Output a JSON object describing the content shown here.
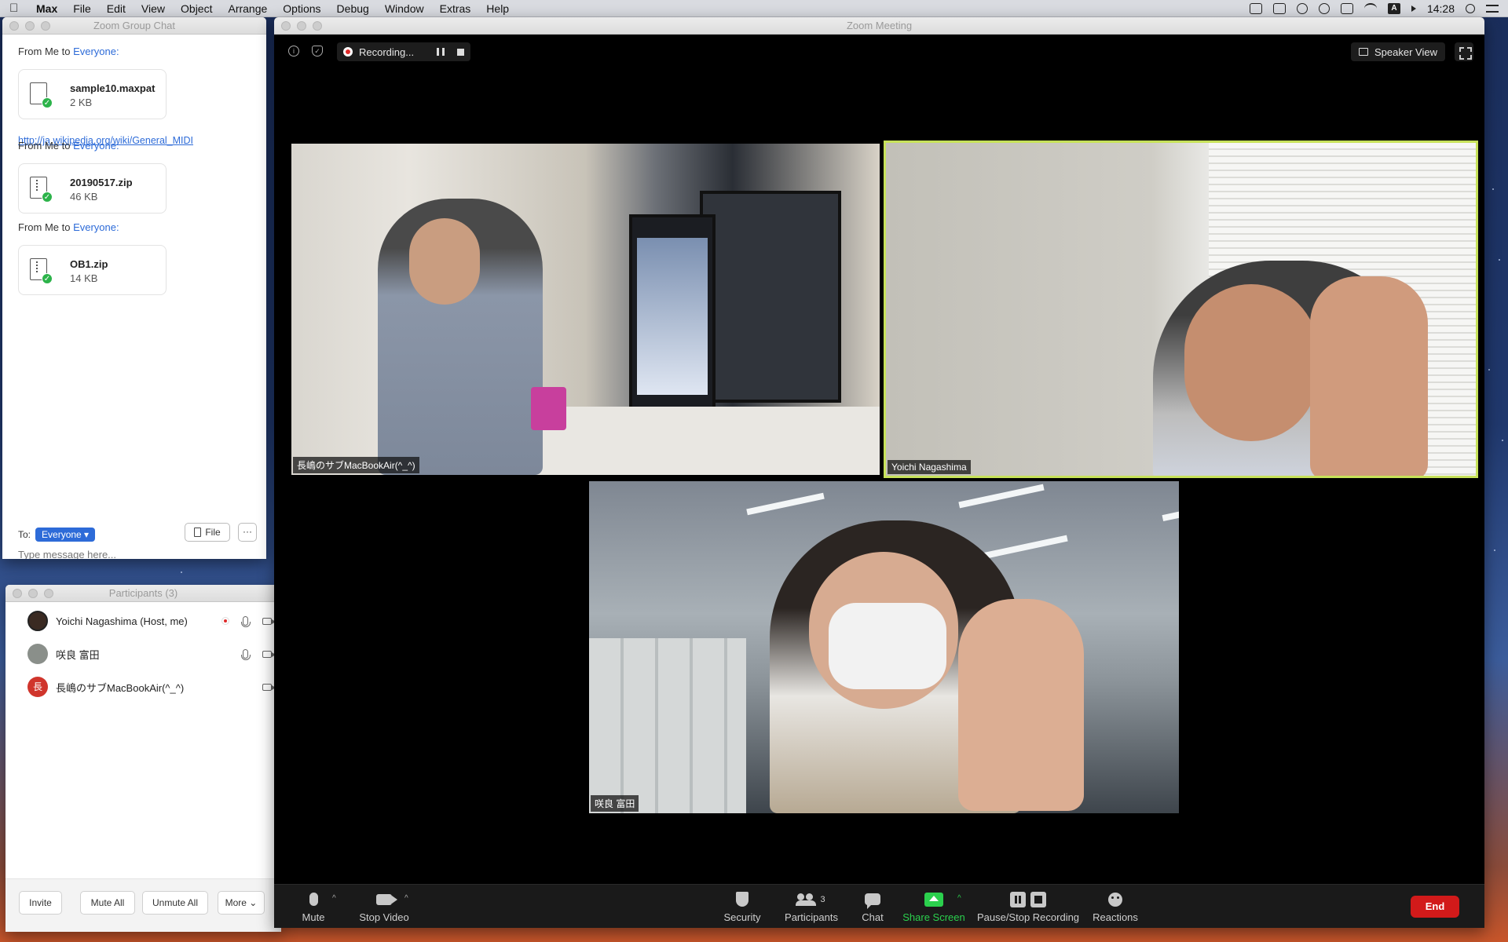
{
  "menubar": {
    "app": "Max",
    "items": [
      "File",
      "Edit",
      "View",
      "Object",
      "Arrange",
      "Options",
      "Debug",
      "Window",
      "Extras",
      "Help"
    ],
    "clock": "14:28",
    "input_indicator": "A"
  },
  "chat": {
    "title": "Zoom Group Chat",
    "messages": [
      {
        "from": "From Me to ",
        "to": "Everyone:",
        "file_name": "sample10.maxpat",
        "file_size": "2 KB"
      },
      {
        "from": "From Me to ",
        "to": "Everyone:",
        "file_name": "20190517.zip",
        "file_size": "46 KB"
      },
      {
        "from": "From Me to ",
        "to": "Everyone:",
        "file_name": "OB1.zip",
        "file_size": "14 KB"
      }
    ],
    "link": "http://ja.wikipedia.org/wiki/General_MIDI",
    "to_label": "To:",
    "recipient": "Everyone",
    "file_button": "File",
    "more_button": "···",
    "input_placeholder": "Type message here..."
  },
  "participants": {
    "title": "Participants (3)",
    "list": [
      {
        "name": "Yoichi Nagashima (Host, me)",
        "avatar": "",
        "avatar_color": "#3a2a22"
      },
      {
        "name": "咲良 富田",
        "avatar": "",
        "avatar_color": "#8a8f8a"
      },
      {
        "name": "長嶋のサブMacBookAir(^_^)",
        "avatar": "長",
        "avatar_color": "#d0352c"
      }
    ],
    "buttons": {
      "invite": "Invite",
      "mute_all": "Mute All",
      "unmute_all": "Unmute All",
      "more": "More ⌄"
    }
  },
  "meeting": {
    "title": "Zoom Meeting",
    "recording_label": "Recording...",
    "speaker_view": "Speaker View",
    "tiles": [
      {
        "name": "長嶋のサブMacBookAir(^_^)"
      },
      {
        "name": "Yoichi Nagashima"
      },
      {
        "name": "咲良 富田"
      }
    ],
    "toolbar": {
      "mute": "Mute",
      "stop_video": "Stop Video",
      "security": "Security",
      "participants": "Participants",
      "participants_count": "3",
      "chat": "Chat",
      "share_screen": "Share Screen",
      "recording": "Pause/Stop Recording",
      "reactions": "Reactions",
      "end": "End"
    }
  },
  "colors": {
    "accent_blue": "#2d6bd8",
    "share_green": "#2bd04d",
    "end_red": "#d21a1a",
    "active_speaker": "#c7e25a"
  }
}
